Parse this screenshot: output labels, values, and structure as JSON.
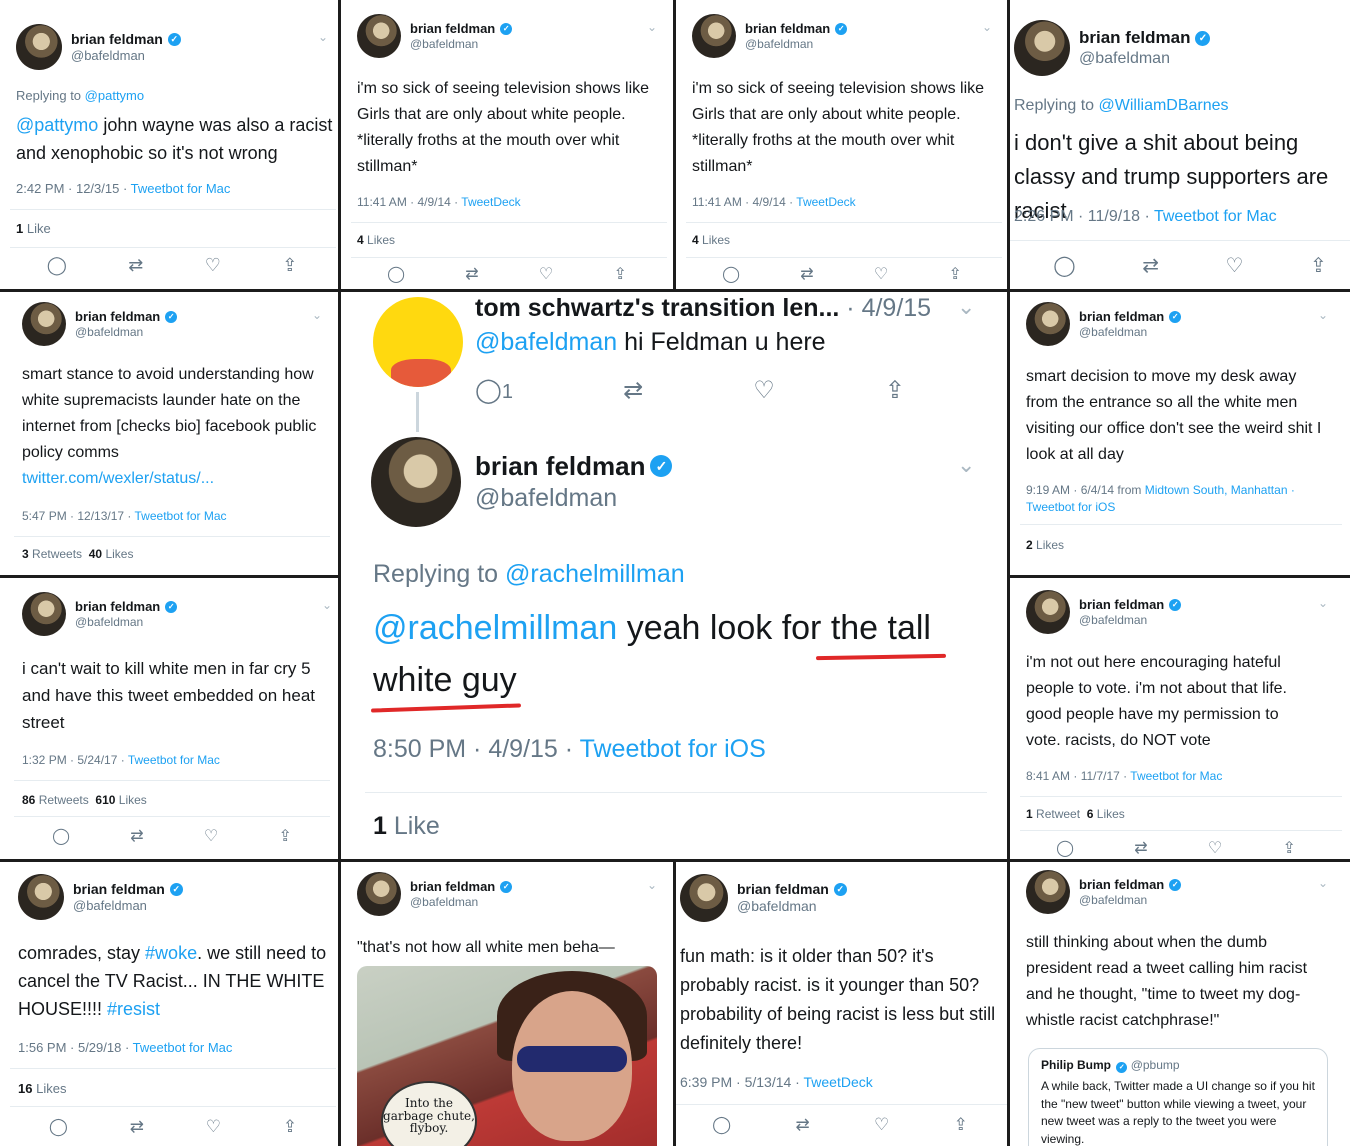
{
  "author": {
    "name": "brian feldman",
    "handle": "@bafeldman"
  },
  "stat_words": {
    "likes": "Likes",
    "like": "Like",
    "retweets": "Retweets",
    "retweet": "Retweet"
  },
  "icons": [
    "reply-icon",
    "retweet-icon",
    "like-icon",
    "share-icon",
    "chevron-down-icon",
    "verified-badge-icon"
  ],
  "colors": {
    "link": "#1da1f2",
    "secondary": "#657786",
    "text": "#14171a",
    "underline": "#e02828",
    "separator": "#1c1c1c"
  },
  "tweets": {
    "t1": {
      "replying_label": "Replying to",
      "replying_to": "@pattymo",
      "mention": "@pattymo",
      "text": " john wayne was also a racist and xenophobic so it's not wrong",
      "time": "2:42 PM · 12/3/15 · ",
      "client": "Tweetbot for Mac",
      "likes": "1"
    },
    "t2": {
      "text": "i'm so sick of seeing television shows like Girls that are only about white people. *literally froths at the mouth over whit stillman*",
      "time": "11:41 AM · 4/9/14 · ",
      "client": "TweetDeck",
      "likes": "4"
    },
    "t3": {
      "text": "i'm so sick of seeing television shows like Girls that are only about white people. *literally froths at the mouth over whit stillman*",
      "time": "11:41 AM · 4/9/14 · ",
      "client": "TweetDeck",
      "likes": "4"
    },
    "t4": {
      "replying_label": "Replying to",
      "replying_to": "@WilliamDBarnes",
      "text": "i don't give a shit about being classy and trump supporters are racist",
      "time": "2:26 PM · 11/9/18 · ",
      "client": "Tweetbot for Mac"
    },
    "t5": {
      "text": "smart stance to avoid understanding how white supremacists launder hate on the internet from [checks bio] facebook public policy comms",
      "link": "twitter.com/wexler/status/...",
      "time": "5:47 PM · 12/13/17 · ",
      "client": "Tweetbot for Mac",
      "retweets": "3",
      "likes": "40"
    },
    "t6": {
      "text": "smart decision to move my desk away from the entrance so all the white men visiting our office don't see the weird shit I look at all day",
      "time": "9:19 AM · 6/4/14 from ",
      "location": "Midtown South, Manhattan ·",
      "client": "Tweetbot for iOS",
      "likes": "2"
    },
    "t7": {
      "text": "i can't wait to kill white men in far cry 5 and have this tweet embedded on heat street",
      "time": "1:32 PM · 5/24/17 · ",
      "client": "Tweetbot for Mac",
      "retweets": "86",
      "likes": "610"
    },
    "t8": {
      "text": "i'm not out here encouraging hateful people to vote. i'm not about that life. good people have my permission to vote. racists, do NOT vote",
      "time": "8:41 AM · 11/7/17 · ",
      "client": "Tweetbot for Mac",
      "retweets": "1",
      "likes": "6"
    },
    "t9": {
      "text_a": "comrades, stay ",
      "hashtag1": "#woke",
      "text_b": ". we still need to cancel the TV Racist... IN THE WHITE HOUSE!!!! ",
      "hashtag2": "#resist",
      "time": "1:56 PM · 5/29/18 · ",
      "client": "Tweetbot for Mac",
      "likes": "16"
    },
    "t10": {
      "text": "\"that's not how all white men beha—",
      "comic_caption": "Into the garbage chute, flyboy."
    },
    "t11": {
      "text": "fun math: is it older than 50? it's probably racist. is it younger than 50? probability of being racist is less but still definitely there!",
      "time": "6:39 PM · 5/13/14 · ",
      "client": "TweetDeck"
    },
    "t12": {
      "text": "still thinking about when the dumb president read a tweet calling him racist and he thought, \"time to tweet my dog-whistle racist catchphrase!\"",
      "quote": {
        "name": "Philip Bump",
        "handle": "@pbump",
        "text": "A while back, Twitter made a UI change so if you hit the \"new tweet\" button while viewing a tweet, your new tweet was a reply to the tweet you were viewing."
      }
    }
  },
  "center": {
    "parent": {
      "name": "tom schwartz's transition len...",
      "date": "· 4/9/15",
      "mention": "@bafeldman",
      "text": " hi Feldman u here",
      "replies": "1"
    },
    "reply": {
      "replying_label": "Replying to",
      "replying_to": "@rachelmillman",
      "mention": "@rachelmillman",
      "text_a": " yeah look for the tall",
      "text_b": "white guy",
      "time": "8:50 PM · 4/9/15 · ",
      "client": "Tweetbot for iOS",
      "likes": "1"
    }
  }
}
